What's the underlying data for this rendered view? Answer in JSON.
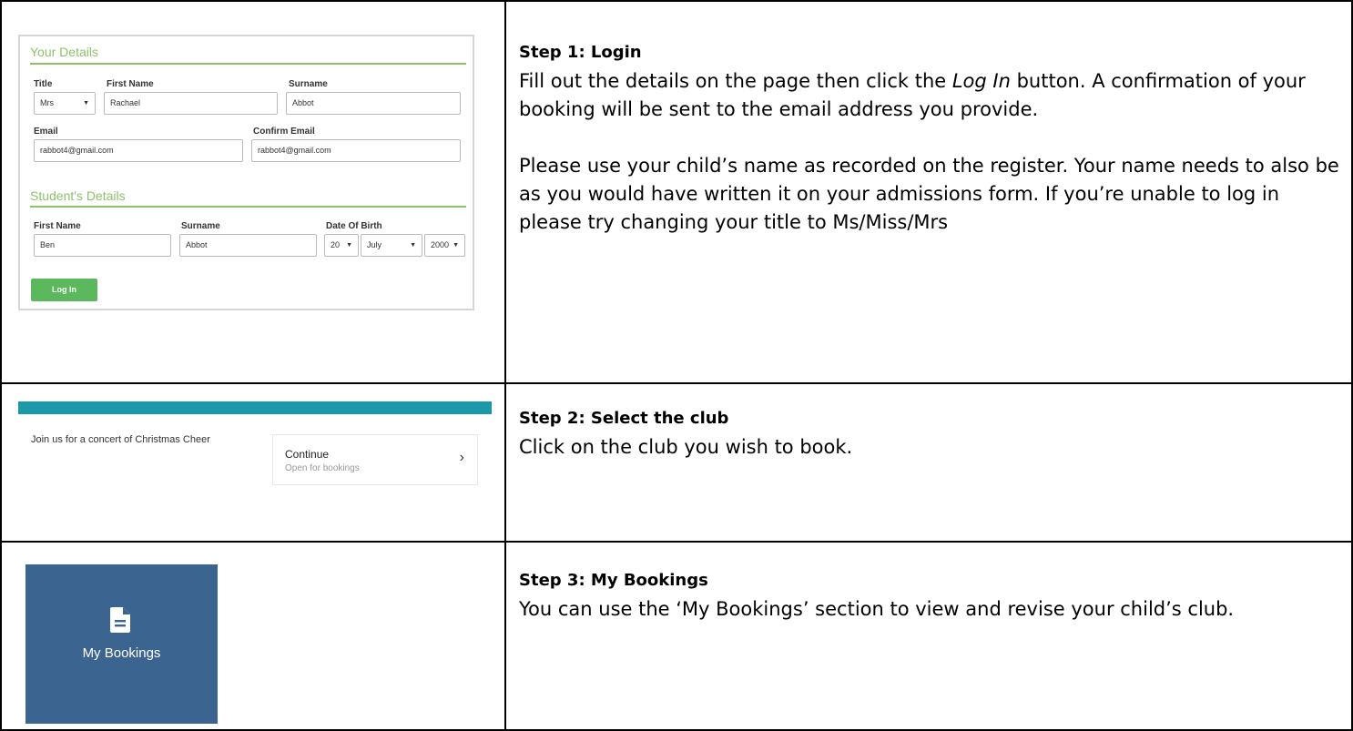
{
  "step1": {
    "title": "Step 1: Login",
    "paragraph1_pre": "Fill out the details on the page then click the ",
    "paragraph1_em": "Log In",
    "paragraph1_post": " button. A confirmation of your booking will be sent to the email address you provide.",
    "paragraph2": "Please use your child’s name as recorded on the register. Your name needs to also be as you would have written it on your admissions form. If you’re unable to log in please try changing your title to Ms/Miss/Mrs"
  },
  "form": {
    "your_details_heading": "Your Details",
    "title_label": "Title",
    "title_value": "Mrs",
    "first_name_label": "First Name",
    "first_name_value": "Rachael",
    "surname_label": "Surname",
    "surname_value": "Abbot",
    "email_label": "Email",
    "email_value": "rabbot4@gmail.com",
    "confirm_email_label": "Confirm Email",
    "confirm_email_value": "rabbot4@gmail.com",
    "students_details_heading": "Student's Details",
    "student_first_name_label": "First Name",
    "student_first_name_value": "Ben",
    "student_surname_label": "Surname",
    "student_surname_value": "Abbot",
    "dob_label": "Date Of Birth",
    "dob_day": "20",
    "dob_month": "July",
    "dob_year": "2000",
    "login_button": "Log In",
    "accent_color": "#8dc26b",
    "button_color": "#5cb85c"
  },
  "step2": {
    "title": "Step 2: Select the club",
    "body": "Click on the club you wish to book."
  },
  "club": {
    "description": "Join us for a concert of Christmas Cheer",
    "card_title": "Continue",
    "card_status": "Open for bookings",
    "chevron_icon": "chevron-right-icon",
    "bar_color": "#1a9aa8"
  },
  "step3": {
    "title": "Step 3: My Bookings",
    "body": "You can use the ‘My Bookings’ section to view and revise your child’s club."
  },
  "my_bookings": {
    "label": "My Bookings",
    "icon": "document-icon",
    "tile_color": "#3b6590"
  }
}
